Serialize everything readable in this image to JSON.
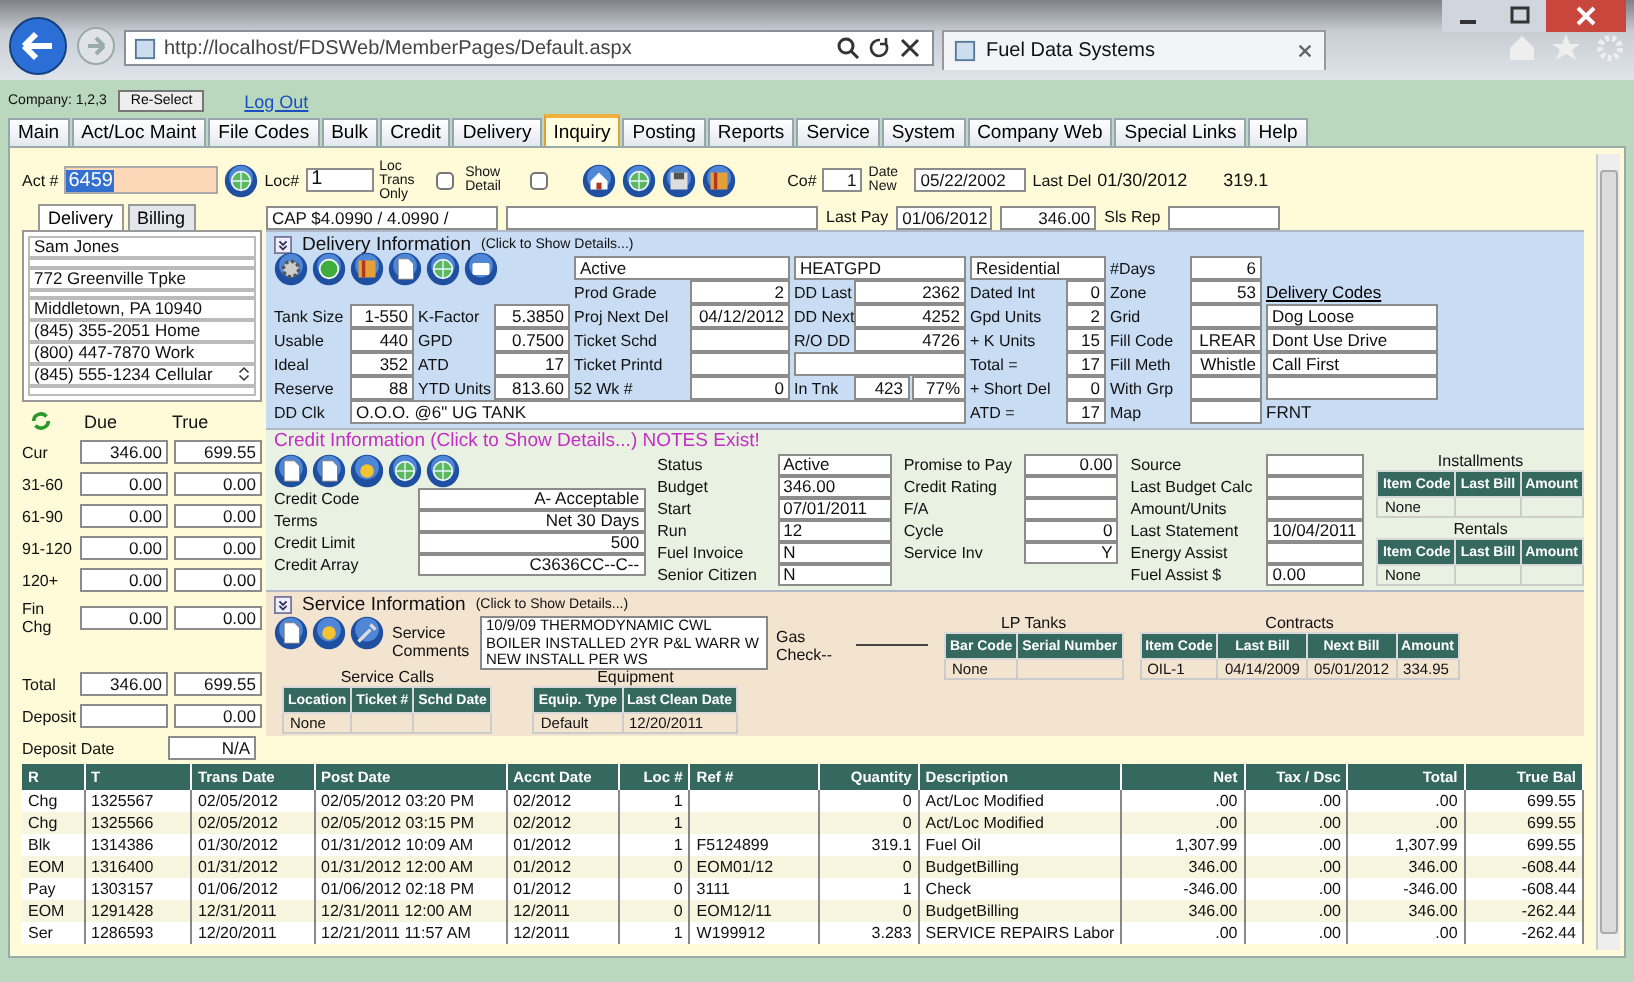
{
  "browser": {
    "address": "http://localhost/FDSWeb/MemberPages/Default.aspx",
    "tab_title": "Fuel Data Systems"
  },
  "header": {
    "company": "Company: 1,2,3",
    "reselect_button": "Re-Select",
    "logout_link": "Log Out"
  },
  "nav_tabs": [
    {
      "label": "Main",
      "selected": false
    },
    {
      "label": "Act/Loc Maint",
      "selected": false
    },
    {
      "label": "File Codes",
      "selected": false
    },
    {
      "label": "Bulk",
      "selected": false
    },
    {
      "label": "Credit",
      "selected": false
    },
    {
      "label": "Delivery",
      "selected": false
    },
    {
      "label": "Inquiry",
      "selected": true
    },
    {
      "label": "Posting",
      "selected": false
    },
    {
      "label": "Reports",
      "selected": false
    },
    {
      "label": "Service",
      "selected": false
    },
    {
      "label": "System",
      "selected": false
    },
    {
      "label": "Company Web",
      "selected": false
    },
    {
      "label": "Special Links",
      "selected": false
    },
    {
      "label": "Help",
      "selected": false
    }
  ],
  "account_bar": {
    "act_label": "Act #",
    "act_value": "6459",
    "loc_label": "Loc#",
    "loc_value": "1",
    "loc_trans_only": {
      "label": "Loc Trans Only",
      "checked": false
    },
    "show_detail": {
      "label": "Show Detail",
      "checked": false
    },
    "co_label": "Co#",
    "co_value": "1",
    "date_new_label": "Date New",
    "date_new_value": "05/22/2002",
    "last_del_label": "Last Del",
    "last_del_date": "01/30/2012",
    "last_del_qty": "319.1"
  },
  "pay_bar": {
    "cap": "CAP $4.0990 / 4.0990 /",
    "last_pay_label": "Last Pay",
    "last_pay_date": "01/06/2012",
    "last_pay_amount": "346.00",
    "sls_rep_label": "Sls Rep"
  },
  "side_tabs": [
    {
      "label": "Delivery",
      "selected": true
    },
    {
      "label": "Billing",
      "selected": false
    }
  ],
  "address_lines": [
    {
      "kind": "line",
      "text": "Sam Jones"
    },
    {
      "kind": "blank"
    },
    {
      "kind": "line",
      "text": "772 Greenville Tpke"
    },
    {
      "kind": "blank"
    },
    {
      "kind": "line",
      "text": "Middletown, PA 10940"
    },
    {
      "kind": "line",
      "text": "(845) 355-2051 Home"
    },
    {
      "kind": "line",
      "text": "(800) 447-7870 Work"
    },
    {
      "kind": "select",
      "text": "(845) 555-1234 Cellular"
    },
    {
      "kind": "blank"
    }
  ],
  "aging": {
    "due_header": "Due",
    "true_header": "True",
    "rows": [
      {
        "label": "Cur",
        "due": "346.00",
        "true": "699.55"
      },
      {
        "label": "31-60",
        "due": "0.00",
        "true": "0.00"
      },
      {
        "label": "61-90",
        "due": "0.00",
        "true": "0.00"
      },
      {
        "label": "91-120",
        "due": "0.00",
        "true": "0.00"
      },
      {
        "label": "120+",
        "due": "0.00",
        "true": "0.00"
      },
      {
        "label": "Fin Chg",
        "due": "0.00",
        "true": "0.00"
      }
    ],
    "total": {
      "label": "Total",
      "due": "346.00",
      "true": "699.55"
    },
    "deposit": {
      "label": "Deposit",
      "true": "0.00"
    },
    "deposit_date": {
      "label": "Deposit Date",
      "true": "N/A"
    }
  },
  "delivery": {
    "title": "Delivery Information",
    "hint": "(Click to Show Details...)",
    "rows": [
      [
        {
          "kind": "icons"
        },
        {
          "kind": "blank"
        },
        {
          "kind": "field",
          "value": "Active"
        },
        {
          "kind": "field",
          "value": "HEATGPD"
        },
        {
          "kind": "field",
          "value": "Residential"
        },
        {
          "kind": "field",
          "label": "#Days",
          "value": "6"
        },
        {
          "kind": "blank"
        }
      ],
      [
        {
          "kind": "blank"
        },
        {
          "kind": "blank"
        },
        {
          "kind": "field",
          "label": "Prod Grade",
          "value": "2"
        },
        {
          "kind": "field",
          "label": "DD Last",
          "value": "2362"
        },
        {
          "kind": "field",
          "label": "Dated Int",
          "value": "0"
        },
        {
          "kind": "field",
          "label": "Zone",
          "value": "53"
        },
        {
          "kind": "link",
          "value": "Delivery Codes"
        }
      ],
      [
        {
          "kind": "field",
          "label": "Tank Size",
          "value": "1-550"
        },
        {
          "kind": "field",
          "label": "K-Factor",
          "value": "5.3850"
        },
        {
          "kind": "field",
          "label": "Proj Next Del",
          "value": "04/12/2012"
        },
        {
          "kind": "field",
          "label": "DD Next",
          "value": "4252"
        },
        {
          "kind": "field",
          "label": "Gpd Units",
          "value": "2"
        },
        {
          "kind": "field",
          "label": "Grid"
        },
        {
          "kind": "field",
          "value": "Dog Loose"
        }
      ],
      [
        {
          "kind": "field",
          "label": "Usable",
          "value": "440"
        },
        {
          "kind": "field",
          "label": "GPD",
          "value": "0.7500"
        },
        {
          "kind": "field",
          "label": "Ticket Schd"
        },
        {
          "kind": "field",
          "label": "R/O DD",
          "value": "4726"
        },
        {
          "kind": "field",
          "label": "+ K Units",
          "value": "15"
        },
        {
          "kind": "field",
          "label": "Fill Code",
          "value": "LREAR"
        },
        {
          "kind": "field",
          "value": "Dont Use Drive"
        }
      ],
      [
        {
          "kind": "field",
          "label": "Ideal",
          "value": "352"
        },
        {
          "kind": "field",
          "label": "ATD",
          "value": "17"
        },
        {
          "kind": "field",
          "label": "Ticket Printd"
        },
        {
          "kind": "field"
        },
        {
          "kind": "field",
          "label": "Total =",
          "value": "17"
        },
        {
          "kind": "field",
          "label": "Fill Meth",
          "value": "Whistle"
        },
        {
          "kind": "field",
          "value": "Call First"
        }
      ],
      [
        {
          "kind": "field",
          "label": "Reserve",
          "value": "88"
        },
        {
          "kind": "field",
          "label": "YTD Units",
          "value": "813.60"
        },
        {
          "kind": "field",
          "label": "52 Wk #",
          "value": "0"
        },
        {
          "kind": "field",
          "label": "In Tnk",
          "value": "423",
          "extra": "77%"
        },
        {
          "kind": "field",
          "label": "+ Short Del",
          "value": "0"
        },
        {
          "kind": "field",
          "label": "With Grp"
        },
        {
          "kind": "field"
        }
      ],
      [
        {
          "kind": "wide",
          "label": "DD Clk",
          "value": "O.O.O. @6\" UG TANK"
        },
        {
          "kind": "blank"
        },
        {
          "kind": "blank"
        },
        {
          "kind": "blank"
        },
        {
          "kind": "field",
          "label": "ATD =",
          "value": "17"
        },
        {
          "kind": "field",
          "label": "Map"
        },
        {
          "kind": "text",
          "value": "FRNT"
        }
      ]
    ]
  },
  "credit": {
    "title": "Credit Information (Click to Show Details...) NOTES Exist!",
    "columns": [
      [
        {
          "label": "Credit Code",
          "value": "A- Acceptable"
        },
        {
          "label": "Terms",
          "value": "Net 30 Days"
        },
        {
          "label": "Credit Limit",
          "value": "500"
        },
        {
          "label": "Credit Array",
          "value": "C3636CC--C--"
        }
      ],
      [
        {
          "label": "Status",
          "value": "Active"
        },
        {
          "label": "Budget",
          "value": "346.00"
        },
        {
          "label": "Start",
          "value": "07/01/2011"
        },
        {
          "label": "Run",
          "value": "12"
        },
        {
          "label": "Fuel Invoice",
          "value": "N"
        },
        {
          "label": "Senior Citizen",
          "value": "N"
        }
      ],
      [
        {
          "label": "Promise to Pay",
          "value": "0.00"
        },
        {
          "label": "Credit Rating"
        },
        {
          "label": "F/A"
        },
        {
          "label": "Cycle",
          "value": "0"
        },
        {
          "label": "Service Inv",
          "value": "Y"
        }
      ],
      [
        {
          "label": "Source"
        },
        {
          "label": "Last Budget Calc"
        },
        {
          "label": "Amount/Units"
        },
        {
          "label": "Last Statement",
          "value": "10/04/2011"
        },
        {
          "label": "Energy Assist"
        },
        {
          "label": "Fuel Assist $",
          "value": "0.00"
        }
      ]
    ],
    "installments": {
      "title": "Installments",
      "columns": [
        "Item Code",
        "Last Bill",
        "Amount"
      ],
      "rows": [
        [
          "None"
        ]
      ]
    },
    "rentals": {
      "title": "Rentals",
      "columns": [
        "Item Code",
        "Last Bill",
        "Amount"
      ],
      "rows": [
        [
          "None"
        ]
      ]
    }
  },
  "service": {
    "title": "Service Information",
    "hint": "(Click to Show Details...)",
    "comments_label": "Service Comments",
    "comments": "10/9/09 THERMODYNAMIC CWL BOILER INSTALLED 2YR P&L WARR W NEW INSTALL PER WS",
    "gas_check_label": "Gas Check--",
    "service_calls": {
      "title": "Service Calls",
      "columns": [
        "Location",
        "Ticket #",
        "Schd Date"
      ],
      "rows": [
        [
          "None"
        ]
      ]
    },
    "equipment": {
      "title": "Equipment",
      "columns": [
        "Equip. Type",
        "Last Clean Date"
      ],
      "rows": [
        [
          "Default",
          "12/20/2011"
        ]
      ]
    },
    "lp_tanks": {
      "title": "LP Tanks",
      "columns": [
        "Bar Code",
        "Serial Number"
      ],
      "rows": [
        [
          "None"
        ]
      ]
    },
    "contracts": {
      "title": "Contracts",
      "columns": [
        "Item Code",
        "Last Bill",
        "Next Bill",
        "Amount"
      ],
      "rows": [
        [
          "OIL-1",
          "04/14/2009",
          "05/01/2012",
          "334.95"
        ]
      ]
    }
  },
  "transactions": {
    "columns": [
      "R",
      "T",
      "Trans Date",
      "Post Date",
      "Accnt Date",
      "Loc #",
      "Ref #",
      "Quantity",
      "Description",
      "Net",
      "Tax / Dsc",
      "Total",
      "True Bal"
    ],
    "rows": [
      {
        "cells": [
          "Chg",
          "1325567",
          "02/05/2012",
          "02/05/2012 03:20 PM",
          "02/2012",
          "1",
          null,
          "0",
          "Act/Loc Modified",
          ".00",
          ".00",
          ".00",
          "699.55"
        ]
      },
      {
        "cells": [
          "Chg",
          "1325566",
          "02/05/2012",
          "02/05/2012 03:15 PM",
          "02/2012",
          "1",
          null,
          "0",
          "Act/Loc Modified",
          ".00",
          ".00",
          ".00",
          "699.55"
        ]
      },
      {
        "cells": [
          "Blk",
          "1314386",
          "01/30/2012",
          "01/31/2012 10:09 AM",
          "01/2012",
          "1",
          "F5124899",
          "319.1",
          "Fuel Oil",
          "1,307.99",
          ".00",
          "1,307.99",
          "699.55"
        ]
      },
      {
        "cells": [
          "EOM",
          "1316400",
          "01/31/2012",
          "01/31/2012 12:00 AM",
          "01/2012",
          "0",
          "EOM01/12",
          "0",
          "BudgetBilling",
          "346.00",
          ".00",
          "346.00",
          "-608.44"
        ]
      },
      {
        "cells": [
          "Pay",
          "1303157",
          "01/06/2012",
          "01/06/2012 02:18 PM",
          "01/2012",
          "0",
          "3111",
          "1",
          "Check",
          "-346.00",
          ".00",
          "-346.00",
          "-608.44"
        ]
      },
      {
        "cells": [
          "EOM",
          "1291428",
          "12/31/2011",
          "12/31/2011 12:00 AM",
          "12/2011",
          "0",
          "EOM12/11",
          "0",
          "BudgetBilling",
          "346.00",
          ".00",
          "346.00",
          "-262.44"
        ]
      },
      {
        "cells": [
          "Ser",
          "1286593",
          "12/20/2011",
          "12/21/2011 11:57 AM",
          "12/2011",
          "1",
          "W199912",
          "3.283",
          "SERVICE REPAIRS Labor",
          ".00",
          ".00",
          ".00",
          "-262.44"
        ]
      }
    ]
  }
}
